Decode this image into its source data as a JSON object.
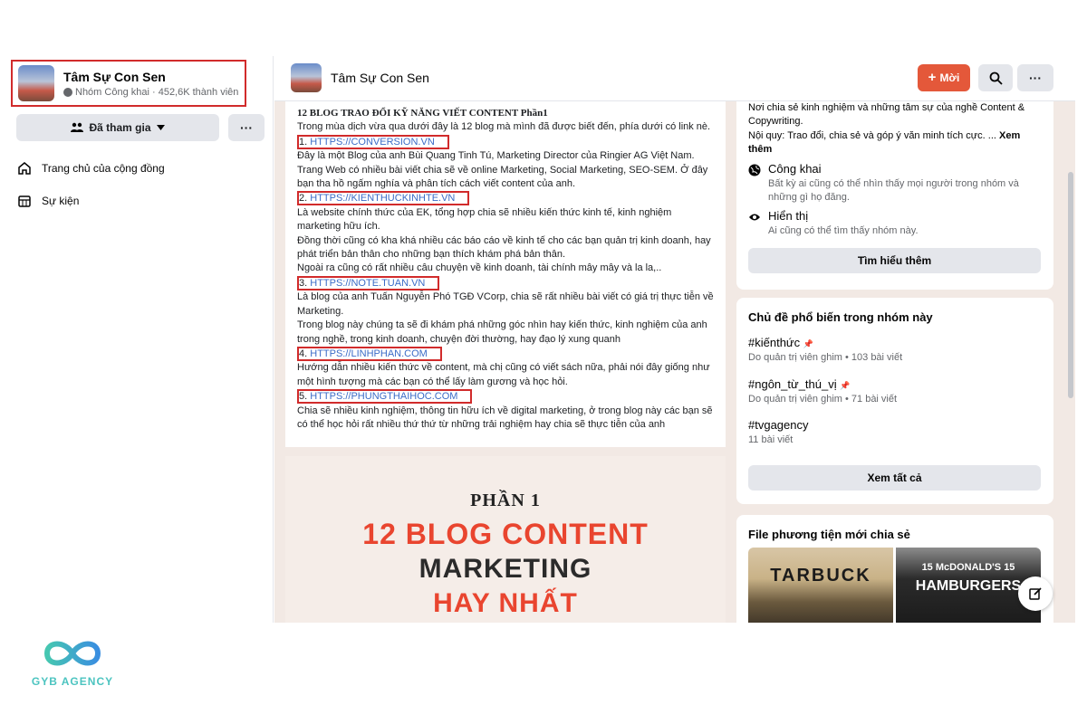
{
  "group": {
    "name": "Tâm Sự Con Sen",
    "meta": "Nhóm Công khai · 452,6K thành viên"
  },
  "sidebar": {
    "joined_label": "Đã tham gia",
    "more_label": "···",
    "items": [
      {
        "label": "Trang chủ của cộng đồng",
        "icon": "home-icon"
      },
      {
        "label": "Sự kiện",
        "icon": "calendar-icon"
      }
    ]
  },
  "topbar": {
    "title": "Tâm Sự Con Sen",
    "invite_label": "Mời",
    "more_label": "···"
  },
  "post": {
    "title": "12 BLOG TRAO ĐỔI KỸ NĂNG VIẾT CONTENT Phần1",
    "intro": "Trong mùa dịch vừa qua dưới đây là 12 blog mà mình đã được biết đến, phía dưới có link nè.",
    "links": [
      {
        "num": "1.",
        "url": "HTTPS://CONVERSION.VN"
      },
      {
        "num": "2.",
        "url": "HTTPS://KIENTHUCKINHTE.VN"
      },
      {
        "num": "3.",
        "url": "HTTPS://NOTE.TUAN.VN"
      },
      {
        "num": "4.",
        "url": "HTTPS://LINHPHAN.COM"
      },
      {
        "num": "5.",
        "url": "HTTPS://PHUNGTHAIHOC.COM"
      }
    ],
    "desc1": "Đây là một Blog của anh Bùi Quang Tinh Tú, Marketing Director của Ringier AG Việt Nam. Trang Web có nhiều bài viết chia sẽ về online Marketing, Social Marketing, SEO-SEM. Ở đây bạn tha hồ ngấm nghía và phân tích cách viết content của anh.",
    "desc2a": "Là website chính thức của EK, tổng hợp chia sẽ nhiều kiến thức kinh tế, kinh nghiệm marketing hữu ích.",
    "desc2b": "Đồng thời cũng có kha khá nhiều các báo cáo về kinh tế cho các bạn quản trị kinh doanh, hay phát triển bản thân cho những bạn thích khám phá bản thân.",
    "desc2c": "Ngoài ra cũng có rất nhiều câu chuyện về kinh doanh, tài chính mây mây và la la,..",
    "desc3a": "Là blog của anh Tuấn Nguyễn Phó TGĐ VCorp, chia sẽ rất nhiều bài viết có giá trị thực tiễn về Marketing.",
    "desc3b": "Trong blog này chúng ta sẽ đi khám phá những góc nhìn hay kiến thức, kinh nghiệm của anh trong nghề, trong kinh doanh, chuyện đời thường, hay đạo lý xung quanh",
    "desc4": "Hướng dẫn nhiều kiến thức về content, mà chị cũng có viết sách nữa, phải nói đây giống như một hình tượng mà các bạn có thể lấy làm gương và học hỏi.",
    "desc5": "Chia sẽ nhiều kinh nghiệm, thông tin hữu ích về digital marketing, ở trong blog này các bạn sẽ có thể học hỏi rất nhiều thứ thứ từ những trải nghiệm hay chia sẽ thực tiễn của anh",
    "image": {
      "part": "PHẦN 1",
      "line1": "12 BLOG CONTENT",
      "line2": "MARKETING",
      "line3": "HAY NHẤT"
    }
  },
  "about": {
    "desc": "Nơi chia sẻ kinh nghiệm và những tâm sự của nghề Content & Copywriting.",
    "rules": "Nội quy: Trao đổi, chia sẻ và góp ý văn minh tích cực. ...",
    "see_more": "Xem thêm",
    "public_title": "Công khai",
    "public_desc": "Bất kỳ ai cũng có thể nhìn thấy mọi người trong nhóm và những gì họ đăng.",
    "visible_title": "Hiển thị",
    "visible_desc": "Ai cũng có thể tìm thấy nhóm này.",
    "learn_more": "Tìm hiểu thêm"
  },
  "topics": {
    "title": "Chủ đề phổ biến trong nhóm này",
    "items": [
      {
        "tag": "#kiếnthức",
        "meta": "Do quản trị viên ghim • 103 bài viết"
      },
      {
        "tag": "#ngôn_từ_thú_vị",
        "meta": "Do quản trị viên ghim • 71 bài viết"
      },
      {
        "tag": "#tvgagency",
        "meta": "11 bài viết"
      }
    ],
    "see_all": "Xem tất cả"
  },
  "media": {
    "title": "File phương tiện mới chia sẻ",
    "img1_text": "TARBUCK",
    "img2_top": "15 McDONALD'S 15",
    "img2_main": "HAMBURGERS"
  },
  "logo": {
    "text": "GYB AGENCY"
  },
  "colors": {
    "accent": "#e4583a",
    "highlight_box": "#d12b2b",
    "link": "#3b6cc7",
    "logo": "#4cc4c0"
  }
}
